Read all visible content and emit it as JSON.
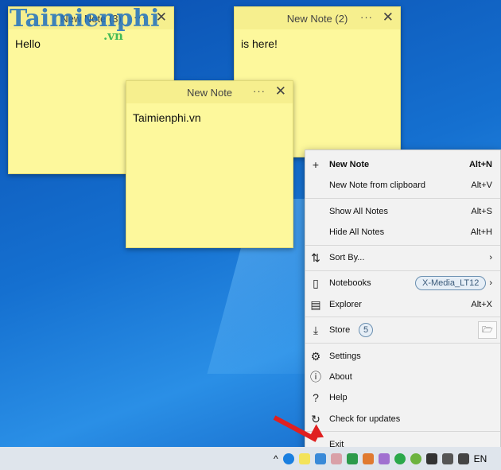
{
  "notes": [
    {
      "title": "New Note (3)",
      "body": "Hello"
    },
    {
      "title": "New Note (2)",
      "body": "is here!"
    },
    {
      "title": "New Note",
      "body": "Taimienphi.vn"
    }
  ],
  "note_controls": {
    "more": "···",
    "close": "✕"
  },
  "watermark": {
    "text": "Taimienphi",
    "suffix": ".vn"
  },
  "menu": {
    "new_note": {
      "label": "New Note",
      "shortcut": "Alt+N"
    },
    "new_clip": {
      "label": "New Note from clipboard",
      "shortcut": "Alt+V"
    },
    "show_all": {
      "label": "Show All Notes",
      "shortcut": "Alt+S"
    },
    "hide_all": {
      "label": "Hide All Notes",
      "shortcut": "Alt+H"
    },
    "sort": {
      "label": "Sort By..."
    },
    "notebooks": {
      "label": "Notebooks",
      "value": "X-Media_LT12"
    },
    "explorer": {
      "label": "Explorer",
      "shortcut": "Alt+X"
    },
    "store": {
      "label": "Store",
      "count": "5"
    },
    "settings": {
      "label": "Settings"
    },
    "about": {
      "label": "About"
    },
    "help": {
      "label": "Help"
    },
    "updates": {
      "label": "Check for updates"
    },
    "exit": {
      "label": "Exit"
    }
  },
  "taskbar": {
    "lang": "EN"
  },
  "colors": {
    "note": "#fdf89c",
    "menu": "#f2f2f2",
    "arrow": "#e02020"
  }
}
